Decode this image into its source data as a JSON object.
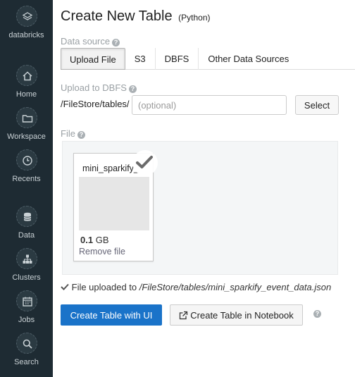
{
  "sidebar": {
    "brand": {
      "label": "databricks",
      "icon": "databricks-logo-icon"
    },
    "items": [
      {
        "label": "Home",
        "icon": "home-icon"
      },
      {
        "label": "Workspace",
        "icon": "folder-icon"
      },
      {
        "label": "Recents",
        "icon": "clock-icon"
      },
      {
        "label": "Data",
        "icon": "database-icon"
      },
      {
        "label": "Clusters",
        "icon": "clusters-icon"
      },
      {
        "label": "Jobs",
        "icon": "calendar-icon"
      },
      {
        "label": "Search",
        "icon": "search-icon"
      }
    ]
  },
  "page": {
    "title": "Create New Table",
    "subtitle": "(Python)"
  },
  "data_source": {
    "label": "Data source",
    "tabs": [
      {
        "label": "Upload File",
        "active": true
      },
      {
        "label": "S3",
        "active": false
      },
      {
        "label": "DBFS",
        "active": false
      },
      {
        "label": "Other Data Sources",
        "active": false
      }
    ]
  },
  "upload_to_dbfs": {
    "label": "Upload to DBFS",
    "path_prefix": "/FileStore/tables/",
    "input_placeholder": "(optional)",
    "input_value": "",
    "select_label": "Select"
  },
  "file": {
    "label": "File",
    "name": "mini_sparkify_",
    "size_value": "0.1",
    "size_unit": "GB",
    "remove_label": "Remove file"
  },
  "status": {
    "prefix": "File uploaded to",
    "path": "/FileStore/tables/mini_sparkify_event_data.json"
  },
  "actions": {
    "create_ui": "Create Table with UI",
    "create_notebook": "Create Table in Notebook"
  },
  "colors": {
    "sidebar_bg": "#1e2b33",
    "primary": "#1a73c9"
  }
}
